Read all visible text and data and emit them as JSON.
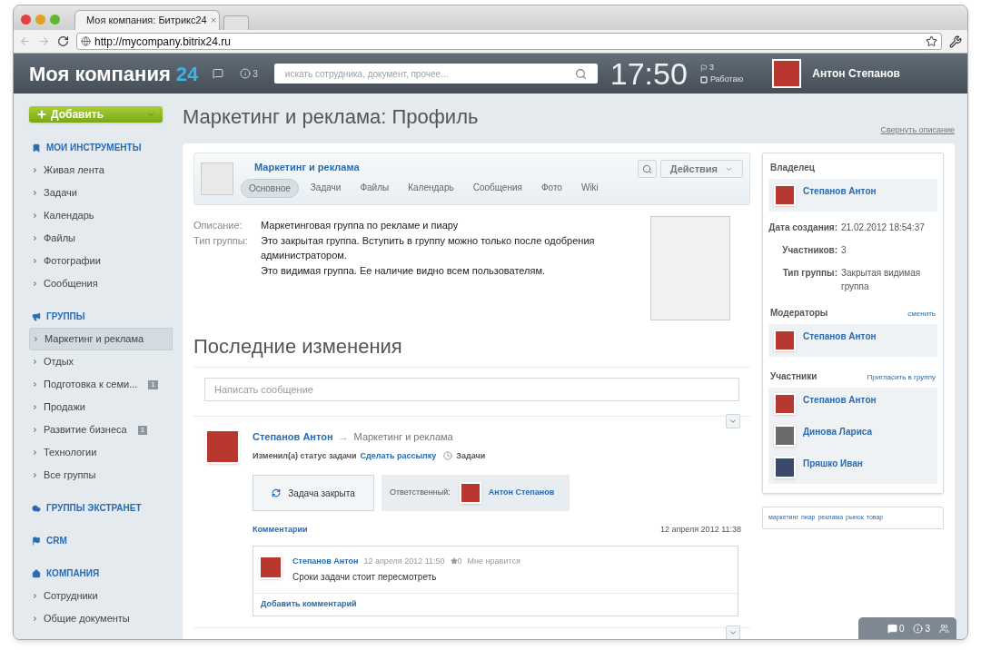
{
  "browser": {
    "tab_title": "Моя компания: Битрикс24",
    "tab_close": "×",
    "url": "http://mycompany.bitrix24.ru"
  },
  "header": {
    "logo": "Моя компания",
    "logo_number": "24",
    "notifications_count": "3",
    "search": {
      "placeholder": "искать сотрудника, документ, прочее..."
    },
    "clock": "17:50",
    "tasks_count": "3",
    "status": "Работаю",
    "user": "Антон Степанов"
  },
  "sidebar": {
    "add_button": "Добавить",
    "sections": [
      {
        "title": "МОИ ИНСТРУМЕНТЫ",
        "items": [
          {
            "label": "Живая лента",
            "selected": false
          },
          {
            "label": "Задачи",
            "selected": false
          },
          {
            "label": "Календарь",
            "selected": false
          },
          {
            "label": "Файлы",
            "selected": false
          },
          {
            "label": "Фотографии",
            "selected": false
          },
          {
            "label": "Сообщения",
            "selected": false
          }
        ]
      },
      {
        "title": "ГРУППЫ",
        "items": [
          {
            "label": "Маркетинг и реклама",
            "selected": true
          },
          {
            "label": "Отдых",
            "selected": false
          },
          {
            "label": "Подготовка к семи...",
            "selected": false,
            "badge": "1"
          },
          {
            "label": "Продажи",
            "selected": false
          },
          {
            "label": "Развитие бизнеса",
            "selected": false,
            "badge": "1"
          },
          {
            "label": "Технологии",
            "selected": false
          },
          {
            "label": "Все группы",
            "selected": false
          }
        ]
      },
      {
        "title": "ГРУППЫ ЭКСТРАНЕТ"
      },
      {
        "title": "CRM"
      },
      {
        "title": "КОМПАНИЯ",
        "items": [
          {
            "label": "Сотрудники",
            "selected": false
          },
          {
            "label": "Общие документы",
            "selected": false
          }
        ]
      }
    ]
  },
  "page_title": "Маркетинг и реклама: Профиль",
  "collapse_link": "Свернуть описание",
  "group": {
    "name": "Маркетинг и реклама",
    "tabs": [
      {
        "label": "Основное",
        "selected": true
      },
      {
        "label": "Задачи",
        "selected": false
      },
      {
        "label": "Файлы",
        "selected": false
      },
      {
        "label": "Календарь",
        "selected": false
      },
      {
        "label": "Сообщения",
        "selected": false
      },
      {
        "label": "Фото",
        "selected": false
      },
      {
        "label": "Wiki",
        "selected": false
      }
    ],
    "actions": "Действия",
    "details": [
      {
        "label": "Описание:",
        "lines": [
          "Маркетинговая группа по рекламе и пиару"
        ]
      },
      {
        "label": "Тип группы:",
        "lines": [
          "Это закрытая группа. Вступить в группу можно только после одобрения администратором.",
          "Это видимая группа. Ее наличие видно всем пользователям."
        ]
      }
    ]
  },
  "feed": {
    "title": "Последние изменения",
    "composer": {
      "placeholder": "Написать сообщение"
    },
    "post": {
      "author": "Степанов Антон",
      "arrow": "→",
      "target": "Маркетинг и реклама",
      "action": "Изменил(а) статус задачи",
      "task_link": "Сделать рассылку",
      "category": "Задачи",
      "status": "Задача закрыта",
      "responsible_label": "Ответственный:",
      "responsible": "Антон Степанов",
      "comments_link": "Комментарии",
      "time": "12 апреля 2012 11:38",
      "comments": [
        {
          "author": "Степанов Антон",
          "time": "12 апреля 2012 11:50",
          "likes": "0",
          "like_label": "Мне нравится",
          "text": "Сроки задачи стоит пересмотреть"
        }
      ],
      "add_comment": "Добавить комментарий"
    }
  },
  "info_panel": {
    "owner_title": "Владелец",
    "owner": "Степанов Антон",
    "facts": [
      {
        "label": "Дата создания:",
        "value": "21.02.2012 18:54:37"
      },
      {
        "label": "Участников:",
        "value": "3"
      },
      {
        "label": "Тип группы:",
        "value": "Закрытая видимая группа"
      }
    ],
    "moderators_title": "Модераторы",
    "moderators_action": "сменить",
    "moderators": [
      "Степанов Антон"
    ],
    "members_title": "Участники",
    "members_action": "Пригласить в группу",
    "members": [
      "Степанов Антон",
      "Динова Лариса",
      "Пряшко Иван"
    ]
  },
  "tags": [
    "маркетинг",
    "пиар",
    "реклама",
    "рынок",
    "товар"
  ],
  "bottom_bar": {
    "messages": "0",
    "notifications": "3"
  }
}
